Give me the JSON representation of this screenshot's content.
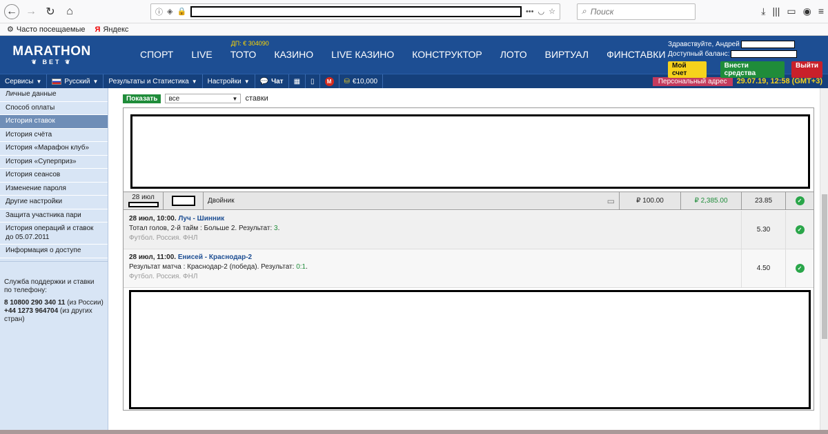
{
  "browser": {
    "search_placeholder": "Поиск",
    "bookmarks": [
      "Часто посещаемые",
      "Яндекс"
    ]
  },
  "header": {
    "logo_main": "MARATHON",
    "logo_sub": "BET",
    "toto_badge": "ДП: € 304090",
    "nav": [
      "СПОРТ",
      "LIVE",
      "ТОТО",
      "КАЗИНО",
      "LIVE КАЗИНО",
      "КОНСТРУКТОР",
      "ЛОТО",
      "ВИРТУАЛ",
      "ФИНСТАВКИ"
    ],
    "greeting": "Здравствуйте, Андрей",
    "balance_label": "Доступный баланс:",
    "my_account": "Мой счет",
    "deposit": "Внести средства",
    "exit": "Выйти"
  },
  "toolbar": {
    "services": "Сервисы",
    "language": "Русский",
    "results": "Результаты и Статистика",
    "settings": "Настройки",
    "chat": "Чат",
    "bonus": "€10,000",
    "personal_address": "Персональный адрес",
    "datetime": "29.07.19, 12:58 (GMT+3)"
  },
  "sidebar": {
    "items": [
      "Личные данные",
      "Способ оплаты",
      "История ставок",
      "История счёта",
      "История «Марафон клуб»",
      "История «Суперприз»",
      "История сеансов",
      "Изменение пароля",
      "Другие настройки",
      "Защита участника пари",
      "История операций и ставок до 05.07.2011",
      "Информация о доступе"
    ],
    "active_index": 2,
    "support_title": "Служба поддержки и ставки по телефону:",
    "phone1": "8 10800 290 340 11",
    "phone1_note": "(из России)",
    "phone2": "+44 1273 964704",
    "phone2_note": "(из других стран)"
  },
  "filter": {
    "show_button": "Показать",
    "select_value": "все",
    "suffix": "ставки"
  },
  "bet": {
    "date": "28 июл",
    "type": "Двойник",
    "stake": "₽ 100.00",
    "win": "₽ 2,385.00",
    "coef": "23.85"
  },
  "events": [
    {
      "title": "28 июл, 10:00.",
      "teams": "Луч - Шинник",
      "market_text": "Тотал голов, 2-й тайм : Больше 2. Результат:",
      "result": "3",
      "league": "Футбол. Россия. ФНЛ",
      "coef": "5.30"
    },
    {
      "title": "28 июл, 11:00.",
      "teams": "Енисей - Краснодар-2",
      "market_text": "Результат матча : Краснодар-2 (победа). Результат:",
      "result": "0:1",
      "league": "Футбол. Россия. ФНЛ",
      "coef": "4.50"
    }
  ],
  "colors": {
    "brand_blue": "#1d4e93",
    "green": "#1f8c3a",
    "yellow": "#f6d21c",
    "red": "#c8202a"
  }
}
